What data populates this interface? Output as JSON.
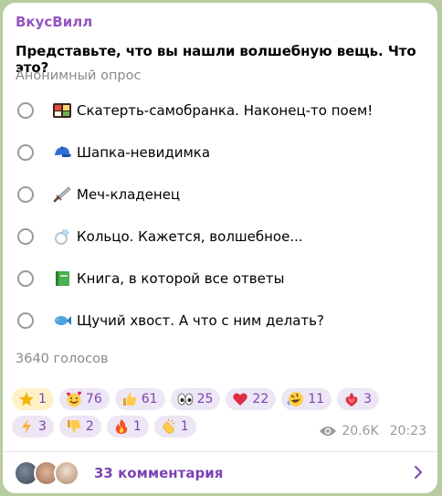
{
  "channel_name": "ВкусВилл",
  "question": "Представьте, что вы нашли волшебную вещь. Что это?",
  "poll_type": "Анонимный опрос",
  "options": [
    {
      "icon": "bento-box-icon",
      "text": "Скатерть-самобранка. Наконец-то поем!"
    },
    {
      "icon": "blue-cap-icon",
      "text": "Шапка-невидимка"
    },
    {
      "icon": "dagger-icon",
      "text": "Меч-кладенец"
    },
    {
      "icon": "ring-icon",
      "text": "Кольцо. Кажется, волшебное..."
    },
    {
      "icon": "green-book-icon",
      "text": "Книга, в которой все ответы"
    },
    {
      "icon": "fish-icon",
      "text": "Щучий хвост. А что с ним делать?"
    }
  ],
  "votes_text": "3640 голосов",
  "reactions": [
    {
      "icon": "star-icon",
      "count": "1"
    },
    {
      "icon": "smiling-face-with-hearts-icon",
      "count": "76"
    },
    {
      "icon": "thumbs-up-icon",
      "count": "61"
    },
    {
      "icon": "eyes-icon",
      "count": "25"
    },
    {
      "icon": "red-heart-icon",
      "count": "22"
    },
    {
      "icon": "rolling-laughing-icon",
      "count": "11"
    },
    {
      "icon": "heart-on-fire-icon",
      "count": "3"
    },
    {
      "icon": "lightning-icon",
      "count": "3"
    },
    {
      "icon": "thumbs-down-icon",
      "count": "2"
    },
    {
      "icon": "fire-icon",
      "count": "1"
    },
    {
      "icon": "clapping-hands-icon",
      "count": "1"
    }
  ],
  "views": "20.6K",
  "time": "20:23",
  "comments_label": "33 комментария",
  "colors": {
    "accent": "#9457c2",
    "link": "#7b44b4",
    "muted": "#8a8a8a",
    "pill_bg": "#ede6f5",
    "background": "#b9cba0"
  }
}
